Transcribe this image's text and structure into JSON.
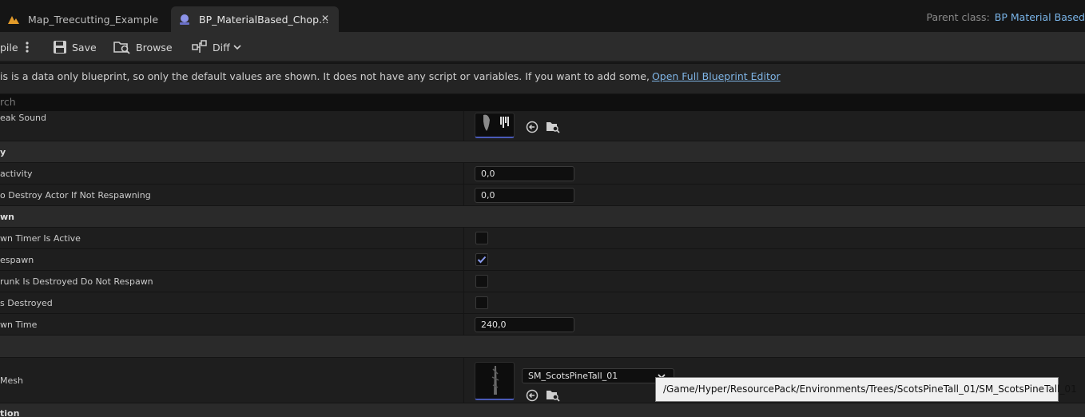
{
  "tabs": [
    {
      "label": "Map_Treecutting_Example",
      "icon": "level-map-icon",
      "icon_color": "#e39b2a"
    },
    {
      "label": "BP_MaterialBased_Chop…",
      "icon": "blueprint-icon",
      "icon_color": "#8c93e8"
    }
  ],
  "parent_class": {
    "label": "Parent class:",
    "value": "BP Material Based"
  },
  "toolbar": {
    "compile_label": "pile",
    "save_label": "Save",
    "browse_label": "Browse",
    "diff_label": "Diff"
  },
  "info": {
    "text": "is is a data only blueprint, so only the default values are shown.  It does not have any script or variables.  If you want to add some,",
    "link": "Open Full Blueprint Editor"
  },
  "search": {
    "placeholder": "rch"
  },
  "properties": {
    "break_sound": {
      "label": "eak Sound"
    },
    "cat1": {
      "label": "y"
    },
    "activity": {
      "label": "activity",
      "value": "0,0"
    },
    "destroy_actor": {
      "label": "o Destroy Actor If Not Respawning",
      "value": "0,0"
    },
    "cat2": {
      "label": "wn"
    },
    "timer_active": {
      "label": "wn Timer Is Active",
      "checked": false
    },
    "respawn": {
      "label": "espawn",
      "checked": true
    },
    "trunk_destroyed": {
      "label": "runk Is Destroyed Do Not Respawn",
      "checked": false
    },
    "is_destroyed": {
      "label": "s Destroyed",
      "checked": false
    },
    "respawn_time": {
      "label": "wn Time",
      "value": "240,0"
    },
    "mesh": {
      "label": "Mesh",
      "asset": "SM_ScotsPineTall_01"
    },
    "cat_bottom": {
      "label": "tion"
    }
  },
  "tooltip": {
    "text": "/Game/Hyper/ResourcePack/Environments/Trees/ScotsPineTall_01/SM_ScotsPineTall_01"
  },
  "colors": {
    "accent": "#4a5ab8",
    "link": "#7fb5e6",
    "checkmark": "#8a9cf0"
  }
}
